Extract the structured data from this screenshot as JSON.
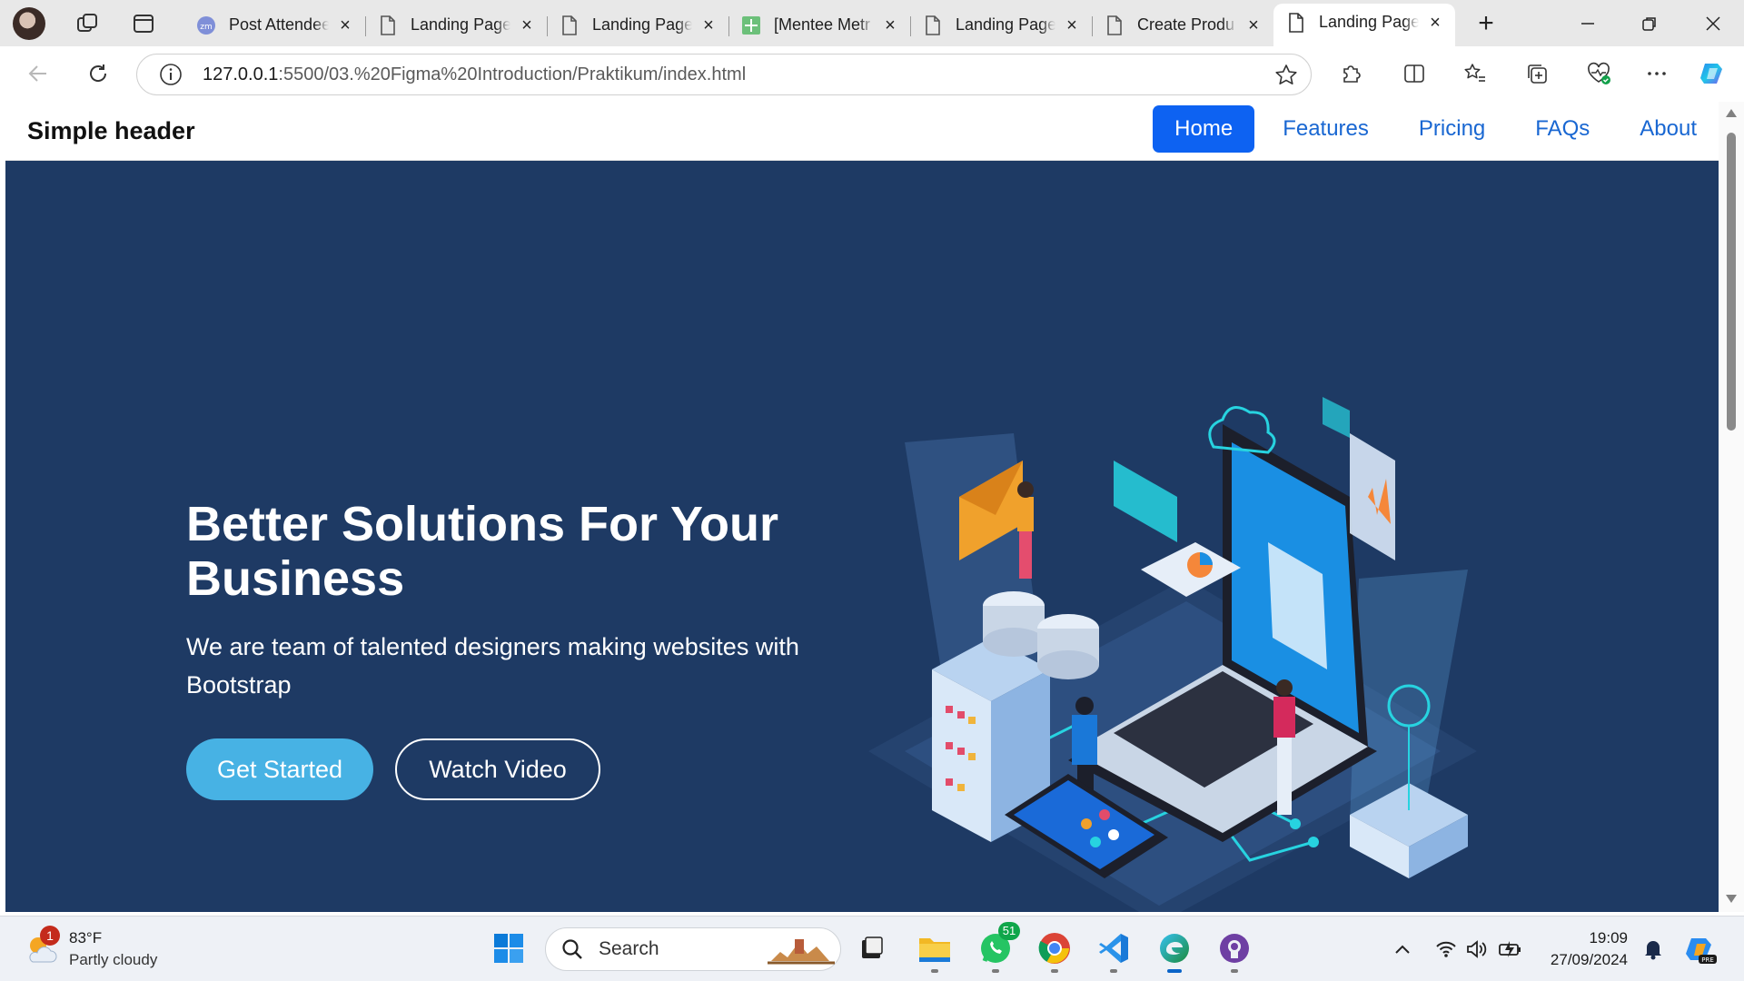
{
  "browser": {
    "tabs": [
      {
        "title": "Post Attendee",
        "favicon": "zoom-icon",
        "active": false
      },
      {
        "title": "Landing Page",
        "favicon": "page-icon",
        "active": false
      },
      {
        "title": "Landing Page",
        "favicon": "page-icon",
        "active": false
      },
      {
        "title": "[Mentee Metr",
        "favicon": "sheets-icon",
        "active": false
      },
      {
        "title": "Landing Page",
        "favicon": "page-icon",
        "active": false
      },
      {
        "title": "Create Produ",
        "favicon": "page-icon",
        "active": false
      },
      {
        "title": "Landing Page",
        "favicon": "page-icon",
        "active": true
      }
    ],
    "url": {
      "host": "127.0.0.1",
      "path": ":5500/03.%20Figma%20Introduction/Praktikum/index.html"
    }
  },
  "page": {
    "brand": "Simple header",
    "nav": [
      {
        "label": "Home",
        "active": true
      },
      {
        "label": "Features",
        "active": false
      },
      {
        "label": "Pricing",
        "active": false
      },
      {
        "label": "FAQs",
        "active": false
      },
      {
        "label": "About",
        "active": false
      }
    ],
    "hero": {
      "title": "Better Solutions For Your Business",
      "subtitle": "We are team of talented designers making websites with Bootstrap",
      "primary_cta": "Get Started",
      "secondary_cta": "Watch Video",
      "illustration": "isometric-laptop-illustration"
    },
    "colors": {
      "hero_bg": "#1e3a64",
      "primary_button": "#47b2e4",
      "nav_active": "#0d62f2",
      "nav_link": "#1967d2"
    }
  },
  "taskbar": {
    "weather": {
      "temp": "83°F",
      "condition": "Partly cloudy",
      "badge": "1"
    },
    "search_placeholder": "Search",
    "whatsapp_badge": "51",
    "clock": {
      "time": "19:09",
      "date": "27/09/2024"
    },
    "apps": [
      "start-icon",
      "file-explorer-icon",
      "folder-icon",
      "whatsapp-icon",
      "chrome-icon",
      "vscode-icon",
      "edge-icon",
      "github-desktop-icon"
    ]
  }
}
